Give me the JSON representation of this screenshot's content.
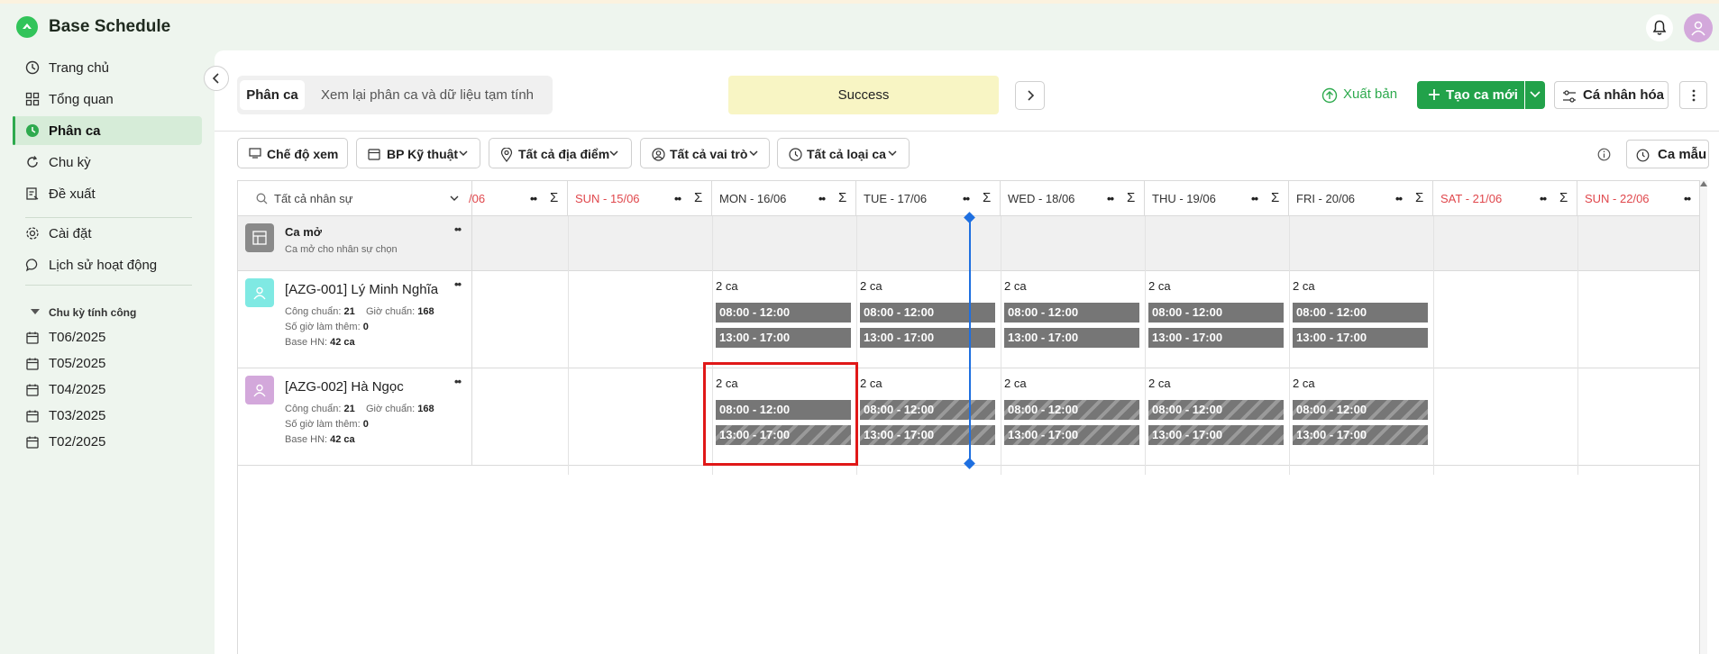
{
  "app": {
    "title": "Base Schedule"
  },
  "sidebar": {
    "items": [
      {
        "label": "Trang chủ",
        "icon": "clock-icon"
      },
      {
        "label": "Tổng quan",
        "icon": "grid-icon"
      },
      {
        "label": "Phân ca",
        "icon": "shift-icon",
        "active": true
      },
      {
        "label": "Chu kỳ",
        "icon": "refresh-icon"
      },
      {
        "label": "Đề xuất",
        "icon": "request-icon"
      },
      {
        "label": "Cài đặt",
        "icon": "gear-icon"
      },
      {
        "label": "Lịch sử hoạt động",
        "icon": "chat-icon"
      }
    ],
    "period_section": "Chu kỳ tính công",
    "periods": [
      "T06/2025",
      "T05/2025",
      "T04/2025",
      "T03/2025",
      "T02/2025"
    ]
  },
  "tabs": {
    "active": "Phân ca",
    "other": "Xem lại phân ca và dữ liệu tạm tính"
  },
  "toast": "Success",
  "toolbar": {
    "publish": "Xuất bản",
    "create": "Tạo ca mới",
    "personalize": "Cá nhân hóa"
  },
  "filters": {
    "view_mode": "Chế độ xem",
    "department": "BP Kỹ thuật",
    "location": "Tất cả địa điểm",
    "role": "Tất cả vai trò",
    "shift_type": "Tất cả loại ca",
    "template": "Ca mẫu"
  },
  "grid": {
    "search_placeholder": "Tất cả nhân sự",
    "days": [
      {
        "label": "/06",
        "weekend": true
      },
      {
        "label": "SUN - 15/06",
        "weekend": true
      },
      {
        "label": "MON - 16/06",
        "weekend": false
      },
      {
        "label": "TUE - 17/06",
        "weekend": false
      },
      {
        "label": "WED - 18/06",
        "weekend": false
      },
      {
        "label": "THU - 19/06",
        "weekend": false
      },
      {
        "label": "FRI - 20/06",
        "weekend": false
      },
      {
        "label": "SAT - 21/06",
        "weekend": true
      },
      {
        "label": "SUN - 22/06",
        "weekend": true
      }
    ],
    "open_shift": {
      "title": "Ca mở",
      "subtitle": "Ca mở cho nhân sự chọn"
    },
    "staff": [
      {
        "name": "[AZG-001] Lý Minh Nghĩa",
        "standard_days_label": "Công chuẩn:",
        "standard_days": "21",
        "standard_hours_label": "Giờ chuẩn:",
        "standard_hours": "168",
        "overtime_label": "Số giờ làm thêm:",
        "overtime": "0",
        "base_label": "Base HN:",
        "base": "42 ca",
        "avatar_color": "#7fe9e3",
        "cells": [
          {
            "count": "2 ca",
            "shifts": [
              "08:00 - 12:00",
              "13:00 - 17:00"
            ]
          },
          {
            "count": "2 ca",
            "shifts": [
              "08:00 - 12:00",
              "13:00 - 17:00"
            ]
          },
          {
            "count": "2 ca",
            "shifts": [
              "08:00 - 12:00",
              "13:00 - 17:00"
            ]
          },
          {
            "count": "2 ca",
            "shifts": [
              "08:00 - 12:00",
              "13:00 - 17:00"
            ]
          },
          {
            "count": "2 ca",
            "shifts": [
              "08:00 - 12:00",
              "13:00 - 17:00"
            ]
          }
        ]
      },
      {
        "name": "[AZG-002] Hà Ngọc",
        "standard_days_label": "Công chuẩn:",
        "standard_days": "21",
        "standard_hours_label": "Giờ chuẩn:",
        "standard_hours": "168",
        "overtime_label": "Số giờ làm thêm:",
        "overtime": "0",
        "base_label": "Base HN:",
        "base": "42 ca",
        "avatar_color": "#d3a8db",
        "cells": [
          {
            "count": "2 ca",
            "shifts": [
              "08:00 - 12:00",
              "13:00 - 17:00"
            ]
          },
          {
            "count": "2 ca",
            "shifts": [
              "08:00 - 12:00",
              "13:00 - 17:00"
            ]
          },
          {
            "count": "2 ca",
            "shifts": [
              "08:00 - 12:00",
              "13:00 - 17:00"
            ]
          },
          {
            "count": "2 ca",
            "shifts": [
              "08:00 - 12:00",
              "13:00 - 17:00"
            ]
          },
          {
            "count": "2 ca",
            "shifts": [
              "08:00 - 12:00",
              "13:00 - 17:00"
            ]
          }
        ]
      }
    ]
  },
  "colors": {
    "brand": "#2eaa4e",
    "weekend": "#e0474c",
    "shift": "#767676",
    "now_line": "#1e6fe0"
  }
}
